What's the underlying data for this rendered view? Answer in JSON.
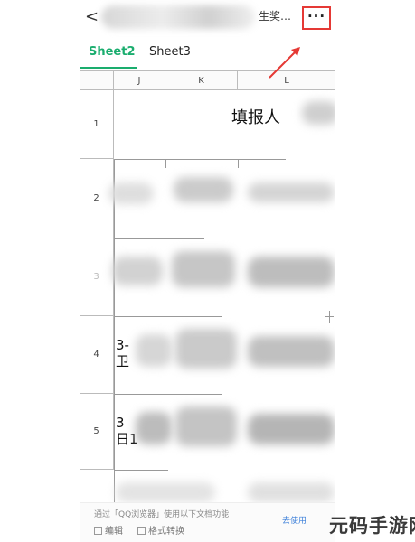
{
  "topbar": {
    "back_glyph": "<",
    "title_tail": "生奖…",
    "more_glyph": "···"
  },
  "tabs": [
    {
      "label": "Sheet2",
      "active": true
    },
    {
      "label": "Sheet3",
      "active": false
    }
  ],
  "grid": {
    "columns": [
      "J",
      "K",
      "L"
    ],
    "rows": [
      "1",
      "2",
      "3",
      "4",
      "5"
    ],
    "cells": {
      "r1_text": "填报人",
      "r4_partial": "3-",
      "r4_partial2": "卫",
      "r5_partial": "3",
      "r5_partial2": "日1"
    }
  },
  "bottom_bar": {
    "hint": "通过「QQ浏览器」使用以下文档功能",
    "go_link": "去使用",
    "edit_label": "编辑",
    "convert_label": "格式转换"
  },
  "watermark": {
    "text": "元码手游网"
  },
  "colors": {
    "accent": "#1aad6e",
    "annotation": "#e53935",
    "link": "#3b7fd9"
  }
}
